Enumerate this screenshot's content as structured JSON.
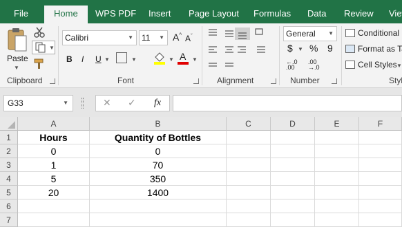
{
  "tabs": [
    {
      "label": "File"
    },
    {
      "label": "Home"
    },
    {
      "label": "WPS PDF"
    },
    {
      "label": "Insert"
    },
    {
      "label": "Page Layout"
    },
    {
      "label": "Formulas"
    },
    {
      "label": "Data"
    },
    {
      "label": "Review"
    },
    {
      "label": "View"
    }
  ],
  "active_tab": "Home",
  "ribbon": {
    "clipboard": {
      "paste_label": "Paste",
      "group_label": "Clipboard"
    },
    "font": {
      "font_name": "Calibri",
      "font_size": "11",
      "bold": "B",
      "italic": "I",
      "underline": "U",
      "group_label": "Font"
    },
    "alignment": {
      "group_label": "Alignment"
    },
    "number": {
      "format": "General",
      "currency": "$",
      "percent": "%",
      "comma": "9",
      "group_label": "Number"
    },
    "styles": {
      "conditional": "Conditional",
      "format_as_table": "Format as Ta",
      "cell_styles": "Cell Styles",
      "group_label": "Styl"
    }
  },
  "formula_bar": {
    "name_box": "G33",
    "fx": "fx",
    "formula": ""
  },
  "sheet": {
    "columns": [
      "A",
      "B",
      "C",
      "D",
      "E",
      "F"
    ],
    "rows": [
      "1",
      "2",
      "3",
      "4",
      "5",
      "6",
      "7"
    ],
    "cells": [
      [
        "Hours",
        "Quantity of Bottles"
      ],
      [
        "0",
        "0"
      ],
      [
        "1",
        "70"
      ],
      [
        "5",
        "350"
      ],
      [
        "20",
        "1400"
      ],
      [
        "",
        ""
      ],
      [
        "",
        ""
      ]
    ]
  },
  "colors": {
    "accent": "#217346"
  }
}
